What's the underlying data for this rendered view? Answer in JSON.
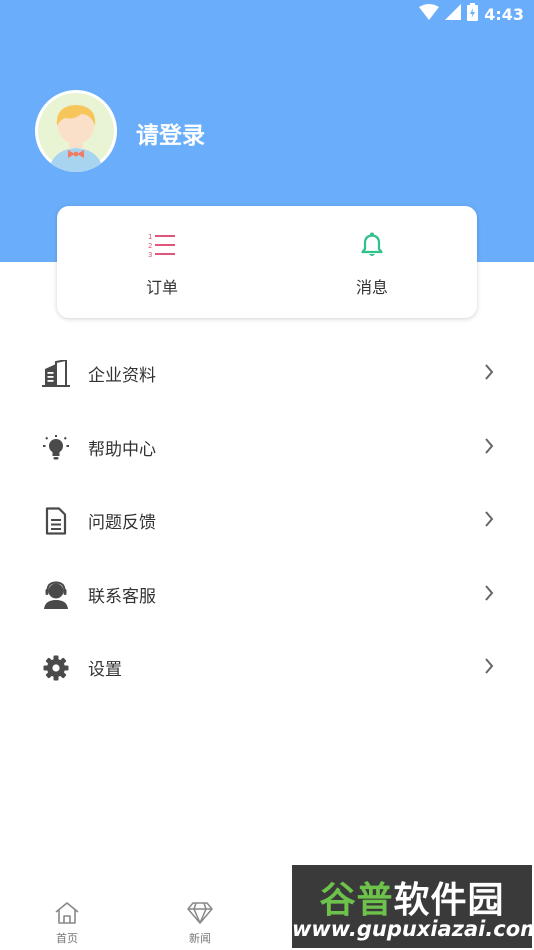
{
  "status_bar": {
    "time": "4:43"
  },
  "profile": {
    "login_prompt": "请登录"
  },
  "quick_actions": [
    {
      "label": "订单",
      "icon": "order-list-icon"
    },
    {
      "label": "消息",
      "icon": "bell-icon"
    }
  ],
  "menu": [
    {
      "label": "企业资料",
      "icon": "building-icon"
    },
    {
      "label": "帮助中心",
      "icon": "lightbulb-icon"
    },
    {
      "label": "问题反馈",
      "icon": "document-icon"
    },
    {
      "label": "联系客服",
      "icon": "customer-service-icon"
    },
    {
      "label": "设置",
      "icon": "gear-icon"
    }
  ],
  "tabs": [
    {
      "label": "首页",
      "icon": "home-icon"
    },
    {
      "label": "新闻",
      "icon": "diamond-icon"
    }
  ],
  "watermark": {
    "title_part1": "谷普",
    "title_part2": "软件园",
    "url": "www.gupuxiazai.com"
  },
  "colors": {
    "header": "#6aaefb",
    "order_icon": "#e0567a",
    "bell_icon": "#2ec28a"
  }
}
